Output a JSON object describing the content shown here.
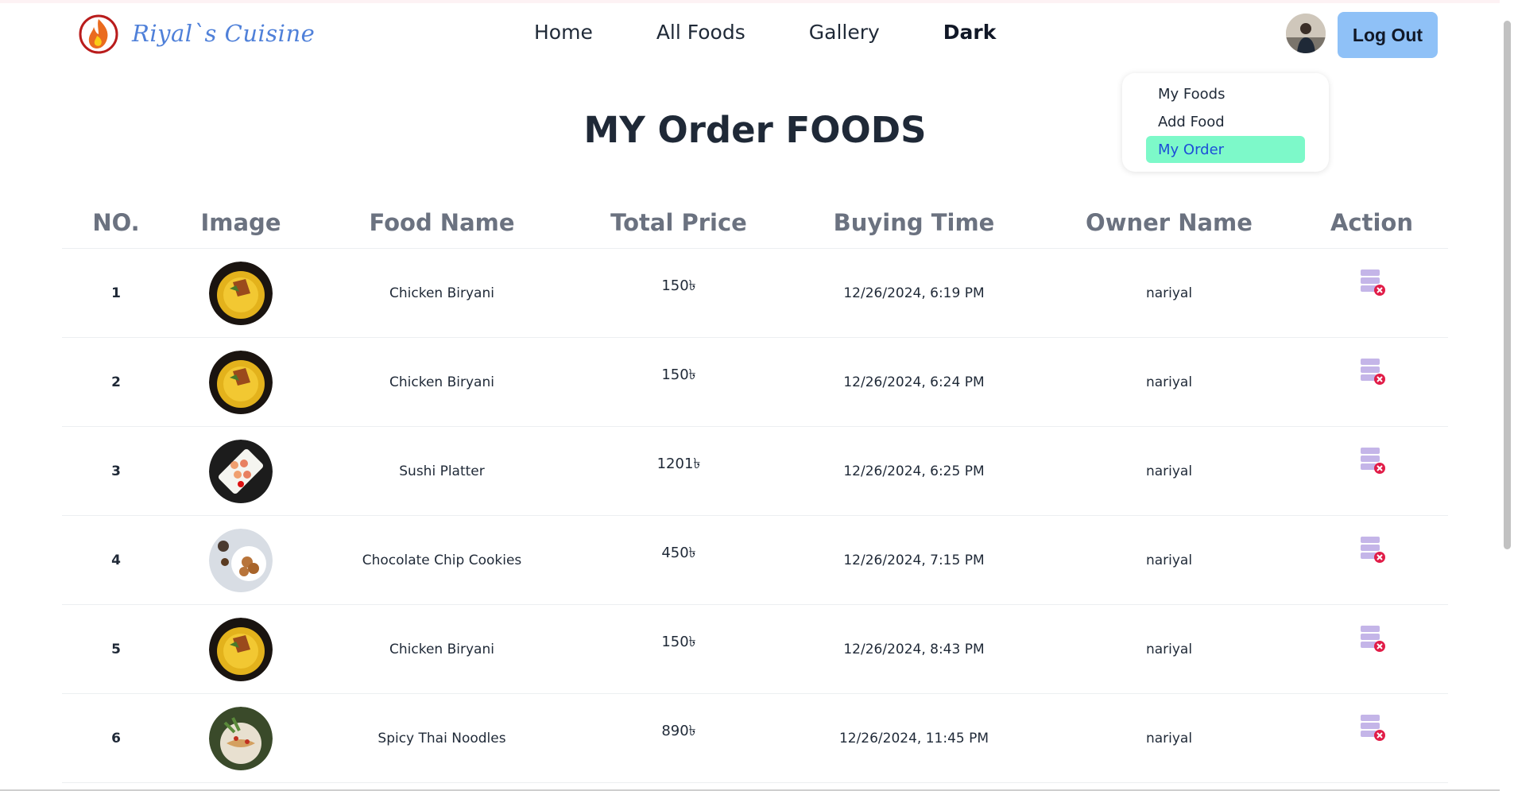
{
  "brand": {
    "name": "Riyal`s Cuisine",
    "logo_icon": "flame-logo-icon"
  },
  "nav": {
    "links": [
      "Home",
      "All Foods",
      "Gallery",
      "Dark"
    ]
  },
  "header": {
    "avatar": "user-avatar",
    "logout_label": "Log Out"
  },
  "dropdown": {
    "items": [
      "My Foods",
      "Add Food",
      "My Order"
    ],
    "active": "My Order"
  },
  "page": {
    "title": "MY Order FOODS"
  },
  "table": {
    "columns": [
      "NO.",
      "Image",
      "Food Name",
      "Total Price",
      "Buying Time",
      "Owner Name",
      "Action"
    ],
    "rows": [
      {
        "no": "1",
        "image": "biryani",
        "food": "Chicken Biryani",
        "price": "150৳",
        "time": "12/26/2024, 6:19 PM",
        "owner": "nariyal",
        "action": "delete-order-icon"
      },
      {
        "no": "2",
        "image": "biryani",
        "food": "Chicken Biryani",
        "price": "150৳",
        "time": "12/26/2024, 6:24 PM",
        "owner": "nariyal",
        "action": "delete-order-icon"
      },
      {
        "no": "3",
        "image": "sushi",
        "food": "Sushi Platter",
        "price": "1201৳",
        "time": "12/26/2024, 6:25 PM",
        "owner": "nariyal",
        "action": "delete-order-icon"
      },
      {
        "no": "4",
        "image": "cookies",
        "food": "Chocolate Chip Cookies",
        "price": "450৳",
        "time": "12/26/2024, 7:15 PM",
        "owner": "nariyal",
        "action": "delete-order-icon"
      },
      {
        "no": "5",
        "image": "biryani",
        "food": "Chicken Biryani",
        "price": "150৳",
        "time": "12/26/2024, 8:43 PM",
        "owner": "nariyal",
        "action": "delete-order-icon"
      },
      {
        "no": "6",
        "image": "noodles",
        "food": "Spicy Thai Noodles",
        "price": "890৳",
        "time": "12/26/2024, 11:45 PM",
        "owner": "nariyal",
        "action": "delete-order-icon"
      }
    ]
  },
  "colors": {
    "brand": "#4f80d9",
    "logout_bg": "#8fc1f7",
    "active_item_bg": "#7df9c9",
    "active_item_text": "#1d4ed8",
    "delete_badge": "#e11d48",
    "action_icon": "#c4b5e8"
  }
}
